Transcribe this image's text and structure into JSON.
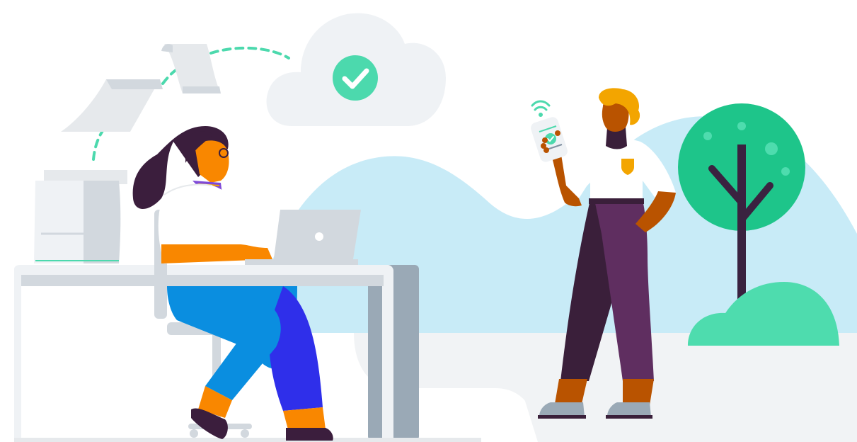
{
  "illustration": {
    "palette": {
      "hill_blue": "#c8ebf7",
      "ground_grey": "#f1f3f5",
      "cloud_grey": "#eff2f5",
      "check_green": "#4cd9ad",
      "tree_green": "#1ec58a",
      "bush_green": "#4edcae",
      "trunk_dark": "#3a2240",
      "skin_orange": "#f98700",
      "skin_brown": "#b95300",
      "hair_dark": "#3b1e3d",
      "hair_yellow": "#f3a500",
      "shirt_white": "#ffffff",
      "jeans_blue": "#0a8ee0",
      "pants_indigo": "#2f2fea",
      "pants_purple": "#5f2e60",
      "pants_dark": "#3a1f3a",
      "laptop_grey": "#d2d8de",
      "desk_leg_grey": "#9aa9b6",
      "paper_grey": "#e6e9ec",
      "connector_dash": "#4cd9ad"
    },
    "icons": {
      "cloud": "cloud-check-icon",
      "wifi": "wifi-icon",
      "check": "check-icon",
      "laptop_logo": "dot-logo-icon",
      "badge": "shield-badge-icon"
    }
  }
}
